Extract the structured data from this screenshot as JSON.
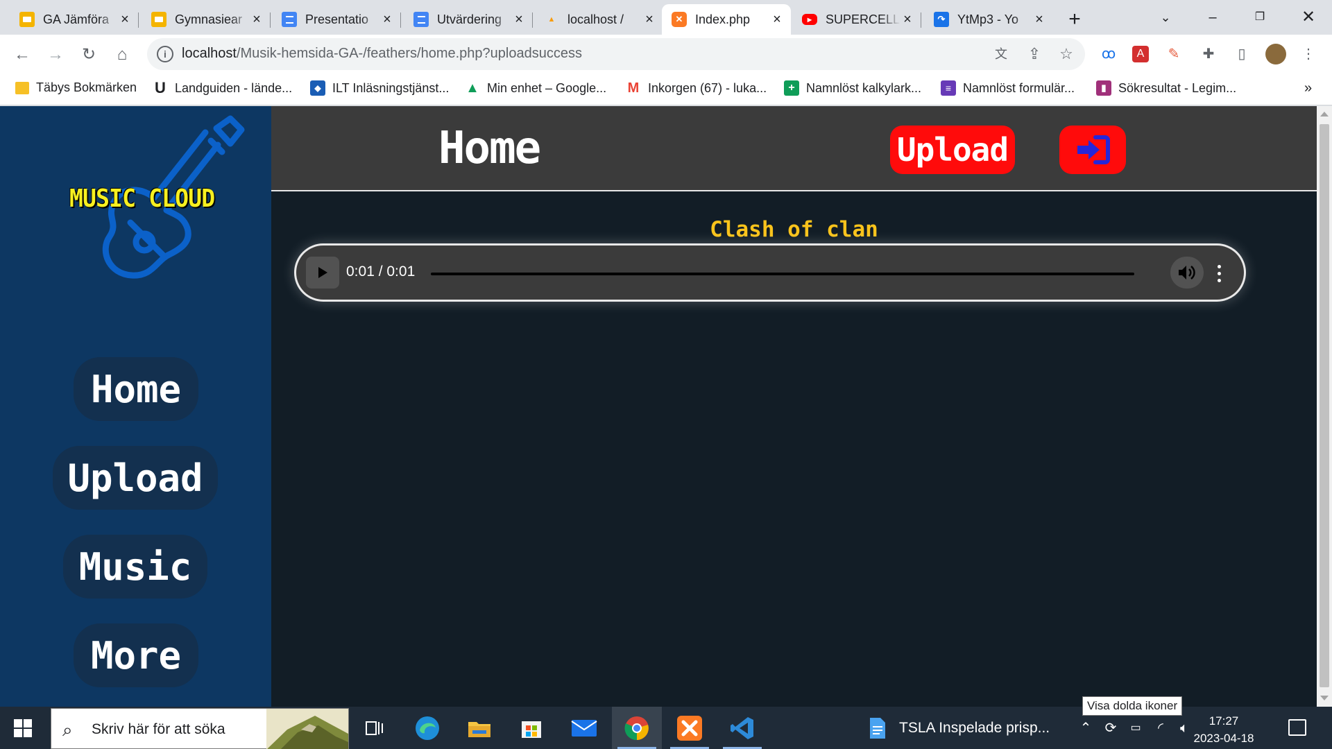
{
  "browser": {
    "tabs": [
      {
        "title": "GA Jämföra",
        "favicon": "slides-icon",
        "color": "#f4b400"
      },
      {
        "title": "Gymnasiear",
        "favicon": "slides-icon",
        "color": "#f4b400"
      },
      {
        "title": "Presentatio",
        "favicon": "docs-icon",
        "color": "#4285f4"
      },
      {
        "title": "Utvärdering",
        "favicon": "docs-icon",
        "color": "#4285f4"
      },
      {
        "title": "localhost /",
        "favicon": "phpmyadmin-icon",
        "color": "#f89c0e"
      },
      {
        "title": "Index.php",
        "favicon": "xampp-icon",
        "color": "#fb7a24",
        "active": true
      },
      {
        "title": "SUPERCELL",
        "favicon": "youtube-icon",
        "color": "#ff0000"
      },
      {
        "title": "YtMp3 - Yo",
        "favicon": "ytmp3-icon",
        "color": "#1a73e8"
      }
    ],
    "url_host": "localhost",
    "url_path": "/Musik-hemsida-GA-/feathers/home.php?uploadsuccess",
    "bookmarks": [
      {
        "label": "Täbys Bokmärken",
        "icon": "folder-icon",
        "color": "#f6c026"
      },
      {
        "label": "Landguiden - lände...",
        "icon": "landguiden-icon",
        "color": "#202124"
      },
      {
        "label": "ILT Inläsningstjänst...",
        "icon": "ilt-icon",
        "color": "#1a5db5"
      },
      {
        "label": "Min enhet – Google...",
        "icon": "drive-icon",
        "color": "#0f9d58"
      },
      {
        "label": "Inkorgen (67) - luka...",
        "icon": "gmail-icon",
        "color": "#ea4335"
      },
      {
        "label": "Namnlöst kalkylark...",
        "icon": "sheets-icon",
        "color": "#0f9d58"
      },
      {
        "label": "Namnlöst formulär...",
        "icon": "forms-icon",
        "color": "#673ab7"
      },
      {
        "label": "Sökresultat - Legim...",
        "icon": "legimus-icon",
        "color": "#a0307a"
      }
    ],
    "bookmarks_overflow": "»"
  },
  "page": {
    "logo_text": "MUSIC CLOUD",
    "title": "Home",
    "upload_button": "Upload",
    "nav": [
      {
        "label": "Home"
      },
      {
        "label": "Upload"
      },
      {
        "label": "Music"
      },
      {
        "label": "More"
      }
    ],
    "songs": [
      {
        "title": "Clash of clan",
        "time": "0:01 / 0:01"
      }
    ]
  },
  "taskbar": {
    "search_placeholder": "Skriv här för att söka",
    "file_label": "TSLA  Inspelade prisp...",
    "time": "17:27",
    "date": "2023-04-18",
    "tooltip": "Visa dolda ikoner"
  }
}
